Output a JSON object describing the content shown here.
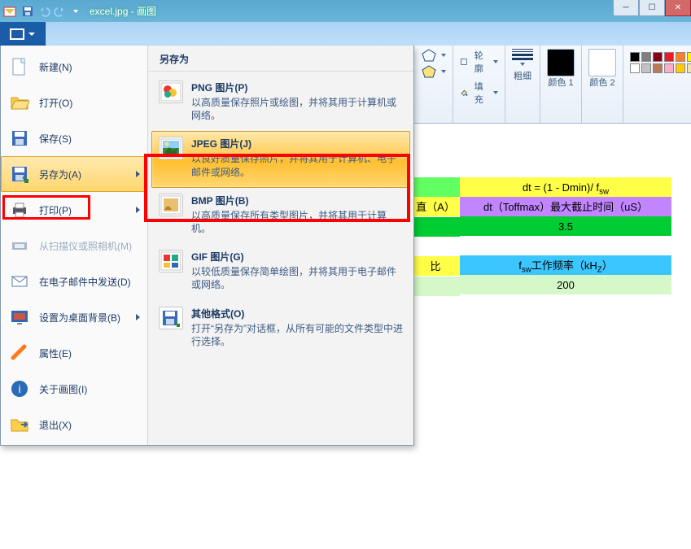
{
  "window": {
    "title": "excel.jpg - 画图"
  },
  "filemenu": {
    "items": [
      {
        "label": "新建(N)"
      },
      {
        "label": "打开(O)"
      },
      {
        "label": "保存(S)"
      },
      {
        "label": "另存为(A)"
      },
      {
        "label": "打印(P)"
      },
      {
        "label": "从扫描仪或照相机(M)"
      },
      {
        "label": "在电子邮件中发送(D)"
      },
      {
        "label": "设置为桌面背景(B)"
      },
      {
        "label": "属性(E)"
      },
      {
        "label": "关于画图(I)"
      },
      {
        "label": "退出(X)"
      }
    ],
    "submenu_title": "另存为",
    "sub": [
      {
        "title": "PNG 图片(P)",
        "desc": "以高质量保存照片或绘图，并将其用于计算机或网络。"
      },
      {
        "title": "JPEG 图片(J)",
        "desc": "以良好质量保存照片，并将其用于计算机、电子邮件或网络。"
      },
      {
        "title": "BMP 图片(B)",
        "desc": "以高质量保存所有类型图片，并将其用于计算机。"
      },
      {
        "title": "GIF 图片(G)",
        "desc": "以较低质量保存简单绘图，并将其用于电子邮件或网络。"
      },
      {
        "title": "其他格式(O)",
        "desc": "打开“另存为”对话框，从所有可能的文件类型中进行选择。"
      }
    ]
  },
  "ribbon": {
    "outline_label": "轮廓",
    "fill_label": "填充",
    "stroke_group": "粗细",
    "color1": "颜色 1",
    "color2": "颜色 2",
    "palette": [
      "#000000",
      "#7f7f7f",
      "#880015",
      "#ed1c24",
      "#ff7f27",
      "#fff200",
      "#22b14c",
      "#00a2e8",
      "#3f48cc",
      "#a349a4",
      "#ffffff",
      "#c3c3c3",
      "#b97a57",
      "#ffaec9",
      "#ffc90e",
      "#efe4b0",
      "#b5e61d",
      "#99d9ea",
      "#7092be",
      "#c8bfe7"
    ]
  },
  "sheet": {
    "r1": "dt = (1 - Dmin)/ fsw",
    "r2a": "dt（Toffmax）",
    "r2b": "最大截止时间（uS）",
    "r3": "3.5",
    "r4": "fsw工作频率（kHZ）",
    "r5": "200",
    "leftHead": "直（A）",
    "leftY2": "比"
  }
}
